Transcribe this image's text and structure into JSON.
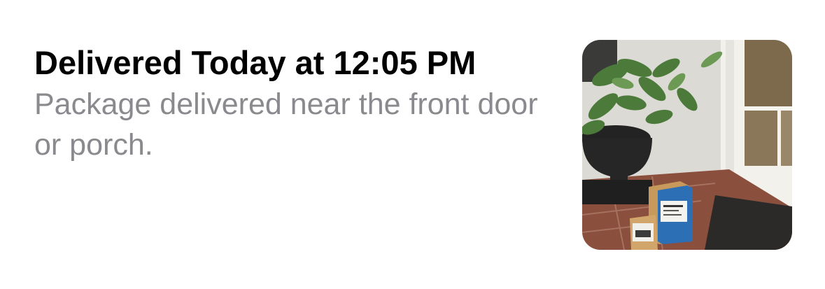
{
  "delivery": {
    "title": "Delivered Today at 12:05 PM",
    "description": "Package delivered near the front door or porch."
  },
  "photo": {
    "icon": "delivery-photo"
  }
}
